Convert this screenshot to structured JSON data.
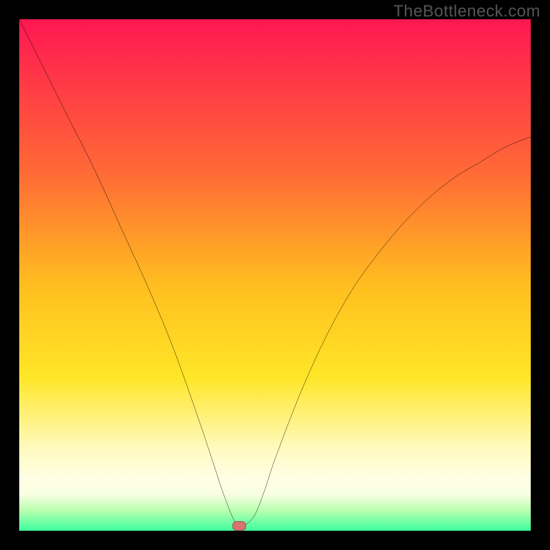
{
  "watermark": "TheBottleneck.com",
  "colors": {
    "frame": "#000000",
    "watermark_text": "#555555",
    "curve": "#000000",
    "marker": "#d6736e",
    "gradient_stops": [
      {
        "pct": 0,
        "hex": "#ff1752"
      },
      {
        "pct": 30,
        "hex": "#ff6a36"
      },
      {
        "pct": 52,
        "hex": "#ffbe1f"
      },
      {
        "pct": 70,
        "hex": "#ffe627"
      },
      {
        "pct": 84,
        "hex": "#fffac0"
      },
      {
        "pct": 90,
        "hex": "#fffee6"
      },
      {
        "pct": 93,
        "hex": "#f7ffe0"
      },
      {
        "pct": 96,
        "hex": "#b9ffb0"
      },
      {
        "pct": 100,
        "hex": "#3dff9e"
      }
    ]
  },
  "chart_data": {
    "type": "line",
    "title": "",
    "xlabel": "",
    "ylabel": "",
    "xlim": [
      0,
      100
    ],
    "ylim": [
      0,
      100
    ],
    "grid": false,
    "legend": false,
    "marker": {
      "x": 43,
      "y": 1
    },
    "series": [
      {
        "name": "bottleneck-curve",
        "x": [
          0,
          5,
          10,
          15,
          20,
          25,
          30,
          35,
          38,
          40,
          42,
          43,
          44,
          46,
          48,
          50,
          55,
          60,
          65,
          70,
          75,
          80,
          85,
          90,
          95,
          100
        ],
        "y": [
          100,
          90,
          80,
          70,
          59,
          48,
          36,
          22,
          13,
          7,
          2,
          1,
          1,
          3,
          8,
          14,
          27,
          38,
          47,
          54,
          60,
          65,
          69,
          72,
          75,
          77
        ]
      }
    ]
  }
}
